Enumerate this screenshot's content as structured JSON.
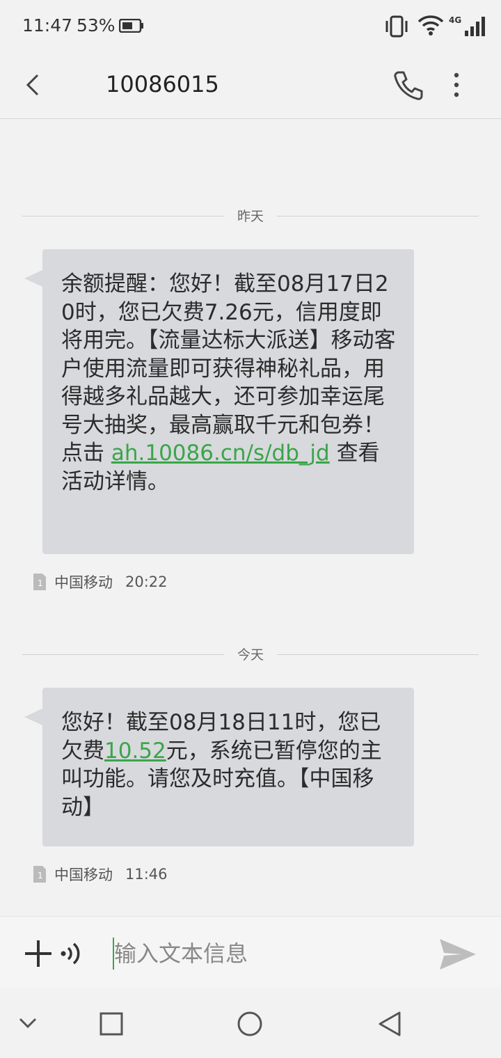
{
  "status": {
    "time": "11:47",
    "battery_pct": "53%",
    "network": "4G"
  },
  "header": {
    "title": "10086015",
    "icons": [
      "back-icon",
      "phone-icon",
      "more-icon"
    ]
  },
  "conversation": {
    "dividers": [
      "昨天",
      "今天"
    ],
    "messages": [
      {
        "text_before": "余额提醒：您好！截至08月17日20时，您已欠费7.26元，信用度即将用完。【流量达标大派送】移动客户使用流量即可获得神秘礼品，用得越多礼品越大，还可参加幸运尾号大抽奖，最高赢取千元和包券！点击 ",
        "link": "ah.10086.cn/s/db_jd",
        "text_after": " 查看活动详情。",
        "carrier": "中国移动",
        "time": "20:22"
      },
      {
        "text_before": "您好！截至08月18日11时，您已欠费",
        "link": "10.52",
        "text_after": "元，系统已暂停您的主叫功能。请您及时充值。【中国移动】",
        "carrier": "中国移动",
        "time": "11:46"
      }
    ]
  },
  "composer": {
    "placeholder": "输入文本信息"
  },
  "colors": {
    "accent": "#3aa54a",
    "bubble": "#d7d9dc",
    "background": "#f2f2f2"
  }
}
